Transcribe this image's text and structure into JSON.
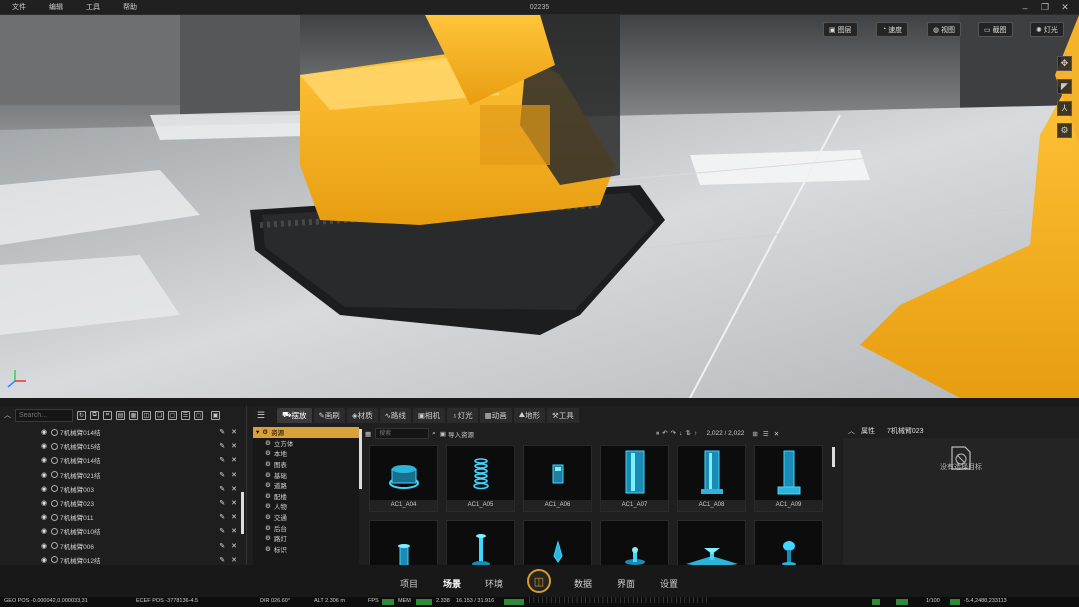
{
  "menubar": {
    "items": [
      "文件",
      "编辑",
      "工具",
      "帮助"
    ],
    "title": "02235"
  },
  "viewport": {
    "top_buttons": [
      "图层",
      "速度",
      "视图",
      "截图",
      "灯光"
    ],
    "side_icons": [
      "move-icon",
      "camera-icon",
      "axis-icon",
      "settings-icon"
    ]
  },
  "left_panel": {
    "search_placeholder": "Search...",
    "rows": [
      "7机械臂014结",
      "7机械臂015结",
      "7机械臂014结",
      "7机械臂021结",
      "7机械臂003",
      "7机械臂023",
      "7机械臂011",
      "7机械臂010结",
      "7机械臂006",
      "7机械臂012结"
    ]
  },
  "mid_panel": {
    "tabs": [
      "摆放",
      "画刷",
      "材质",
      "路线",
      "相机",
      "灯光",
      "动画",
      "地形",
      "工具"
    ],
    "active_tab": 0,
    "categories": [
      "资源",
      "立方体",
      "本地",
      "图表",
      "基础",
      "道路",
      "配楼",
      "人物",
      "交通",
      "后台",
      "路灯",
      "标识"
    ],
    "asset_search_placeholder": "搜索",
    "import_label": "导入资源",
    "paging": "2,022 / 2,022",
    "assets": [
      {
        "name": "AC1_A04"
      },
      {
        "name": "AC1_A05"
      },
      {
        "name": "AC1_A06"
      },
      {
        "name": "AC1_A07"
      },
      {
        "name": "AC1_A08"
      },
      {
        "name": "AC1_A09"
      },
      {
        "name": ""
      },
      {
        "name": ""
      },
      {
        "name": ""
      },
      {
        "name": ""
      },
      {
        "name": ""
      },
      {
        "name": ""
      }
    ]
  },
  "right_panel": {
    "header": "属性",
    "selected": "7机械臂023",
    "empty_text": "没有选择目标"
  },
  "navbar": {
    "items": [
      "项目",
      "场景",
      "环境",
      "数据",
      "界面",
      "设置"
    ],
    "active": "场景"
  },
  "statusbar": {
    "geo_pos": "GEO POS  -0.000042,0.000033,31",
    "ecef_pos": "ECEF POS  -3778136-4.5",
    "dir": "DIR  026.60°",
    "alt": "ALT  2.306 m",
    "fps": "FPS",
    "mem": "MEM",
    "mem_val": "2.338",
    "gpu": "16.153 / 31.916",
    "right": "1/100",
    "coord": "-5.4,2488,233113"
  },
  "colors": {
    "accent": "#d69a2d",
    "asset_glow": "#3fd6ff",
    "status_green": "#2e8b3a"
  }
}
